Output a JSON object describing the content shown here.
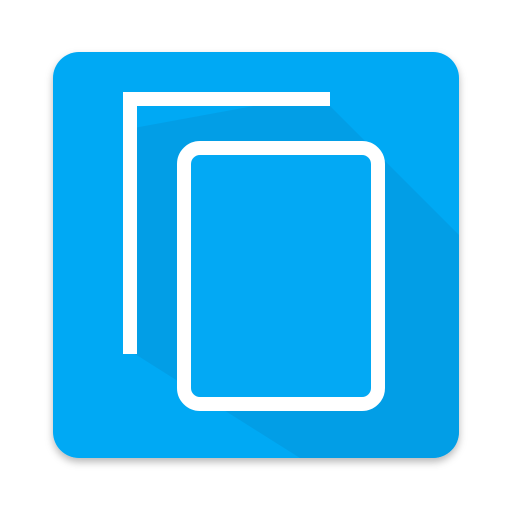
{
  "icon": {
    "name": "copy-documents-icon",
    "colors": {
      "tile": "#03a9f4",
      "tile_shadow": "#0288c7",
      "long_shadow": "#0395da",
      "outline": "#ffffff",
      "page_fill": "#03a9f4"
    }
  }
}
